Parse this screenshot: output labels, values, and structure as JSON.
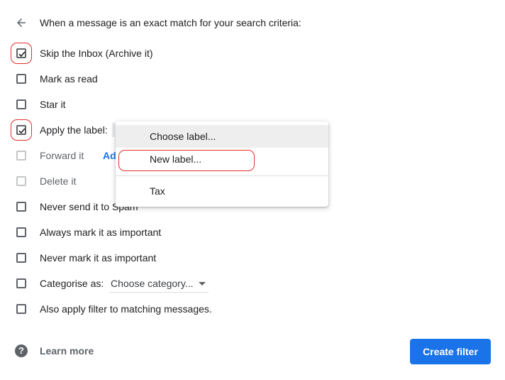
{
  "header": {
    "text": "When a message is an exact match for your search criteria:"
  },
  "options": [
    {
      "label": "Skip the Inbox (Archive it)",
      "checked": true,
      "disabled": false
    },
    {
      "label": "Mark as read",
      "checked": false,
      "disabled": false
    },
    {
      "label": "Star it",
      "checked": false,
      "disabled": false
    },
    {
      "label": "Apply the label:",
      "checked": true,
      "disabled": false
    },
    {
      "label": "Forward it",
      "checked": false,
      "disabled": true
    },
    {
      "label": "Delete it",
      "checked": false,
      "disabled": true
    },
    {
      "label": "Never send it to Spam",
      "checked": false,
      "disabled": false
    },
    {
      "label": "Always mark it as important",
      "checked": false,
      "disabled": false
    },
    {
      "label": "Never mark it as important",
      "checked": false,
      "disabled": false
    },
    {
      "label": "Categorise as:",
      "checked": false,
      "disabled": false
    },
    {
      "label": "Also apply filter to matching messages.",
      "checked": false,
      "disabled": false
    }
  ],
  "forward_link": "Ad",
  "category_select": {
    "value": "Choose category..."
  },
  "label_menu": {
    "items": [
      "Choose label...",
      "New label...",
      "Tax"
    ]
  },
  "footer": {
    "help_icon_glyph": "?",
    "learn_more": "Learn more",
    "create_filter": "Create filter"
  },
  "colors": {
    "accent": "#1a73e8",
    "annotation": "#e0312c",
    "checkbox_border": "#5f6368"
  }
}
